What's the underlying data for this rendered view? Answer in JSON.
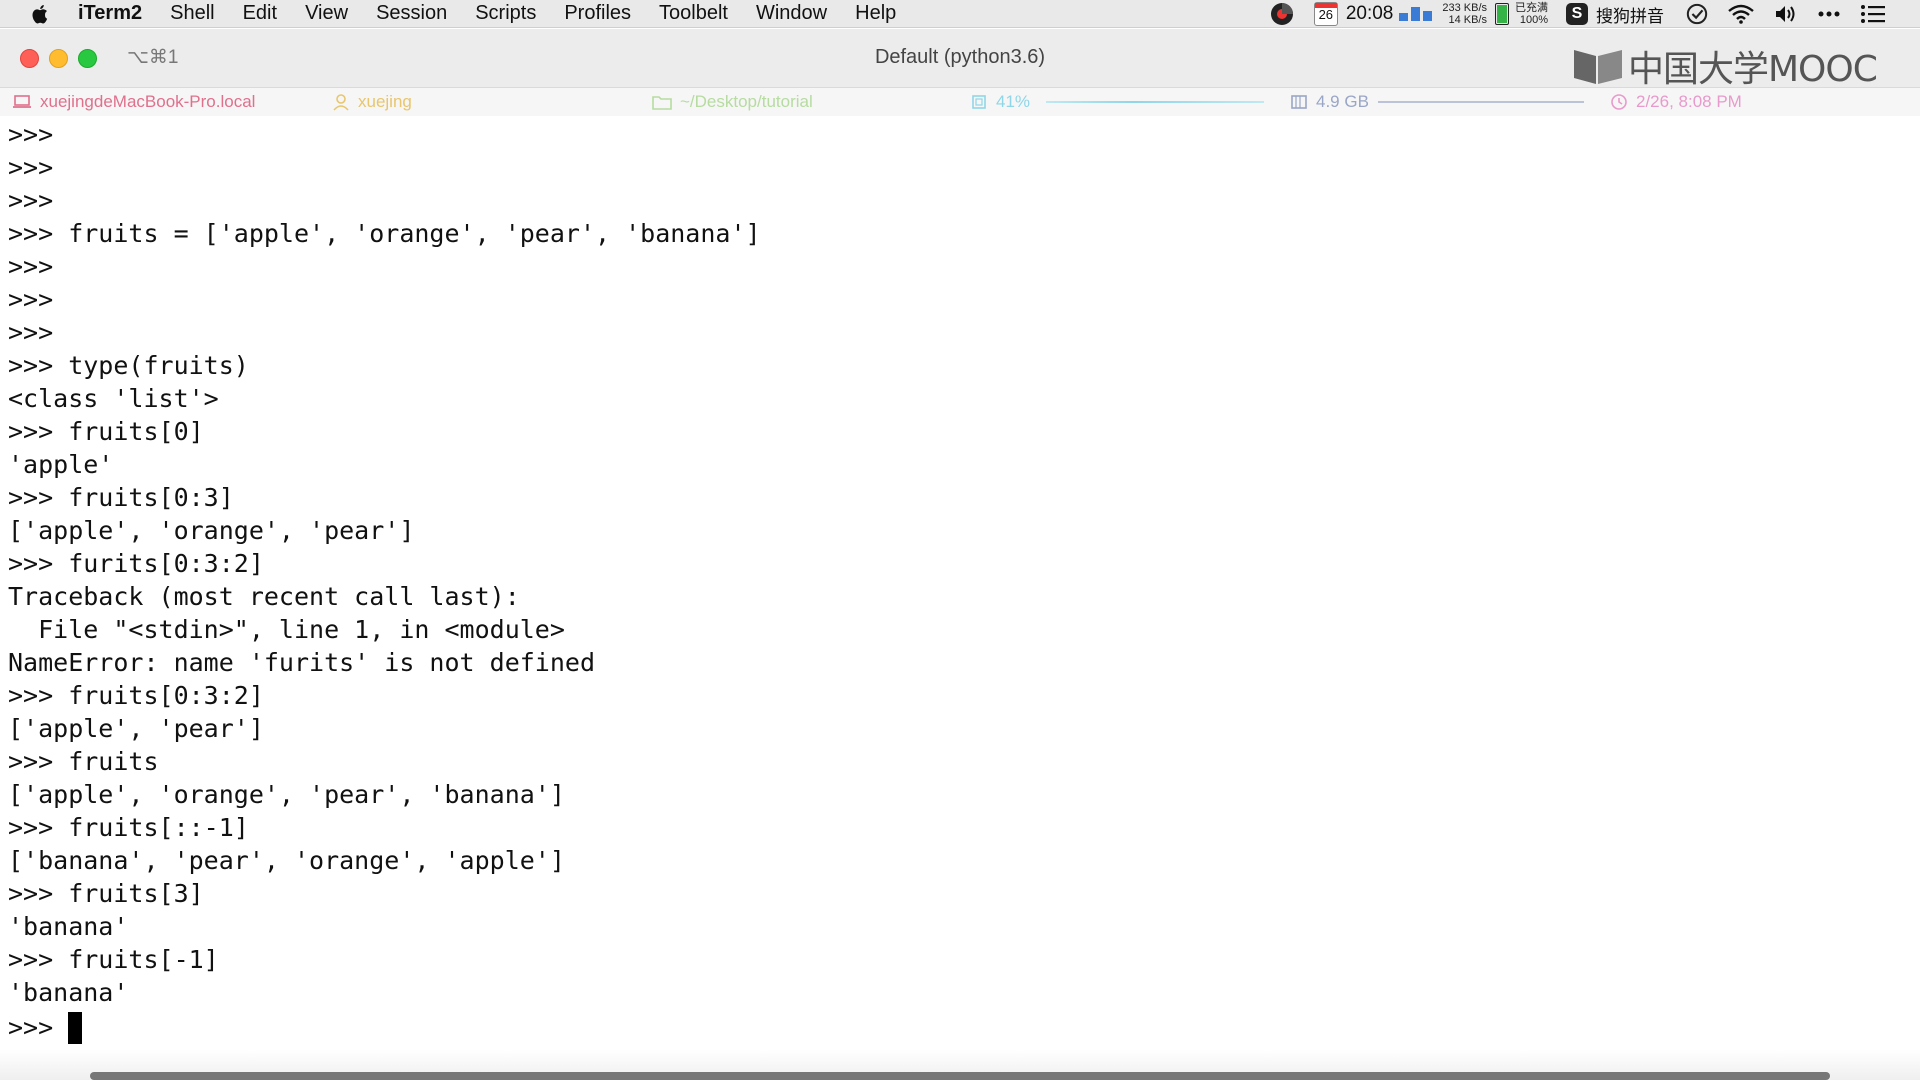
{
  "menubar": {
    "app_name": "iTerm2",
    "items": [
      "Shell",
      "Edit",
      "View",
      "Session",
      "Scripts",
      "Profiles",
      "Toolbelt",
      "Window",
      "Help"
    ],
    "calendar_day": "26",
    "clock": "20:08",
    "net_up": "233 KB/s",
    "net_down": "14 KB/s",
    "battery_status": "已充满",
    "battery_percent": "100%",
    "ime_label": "搜狗拼音"
  },
  "window": {
    "shortcut": "⌥⌘1",
    "title": "Default (python3.6)",
    "logo_text": "中国大学MOOC"
  },
  "statusbar": {
    "host": "xuejingdeMacBook-Pro.local",
    "user": "xuejing",
    "directory": "~/Desktop/tutorial",
    "cpu": "41%",
    "memory": "4.9 GB",
    "datetime": "2/26, 8:08 PM"
  },
  "terminal": {
    "lines": [
      ">>>",
      ">>>",
      ">>>",
      ">>> fruits = ['apple', 'orange', 'pear', 'banana']",
      ">>>",
      ">>>",
      ">>>",
      ">>> type(fruits)",
      "<class 'list'>",
      ">>> fruits[0]",
      "'apple'",
      ">>> fruits[0:3]",
      "['apple', 'orange', 'pear']",
      ">>> furits[0:3:2]",
      "Traceback (most recent call last):",
      "  File \"<stdin>\", line 1, in <module>",
      "NameError: name 'furits' is not defined",
      ">>> fruits[0:3:2]",
      "['apple', 'pear']",
      ">>> fruits",
      "['apple', 'orange', 'pear', 'banana']",
      ">>> fruits[::-1]",
      "['banana', 'pear', 'orange', 'apple']",
      ">>> fruits[3]",
      "'banana'",
      ">>> fruits[-1]",
      "'banana'",
      ">>> "
    ]
  }
}
